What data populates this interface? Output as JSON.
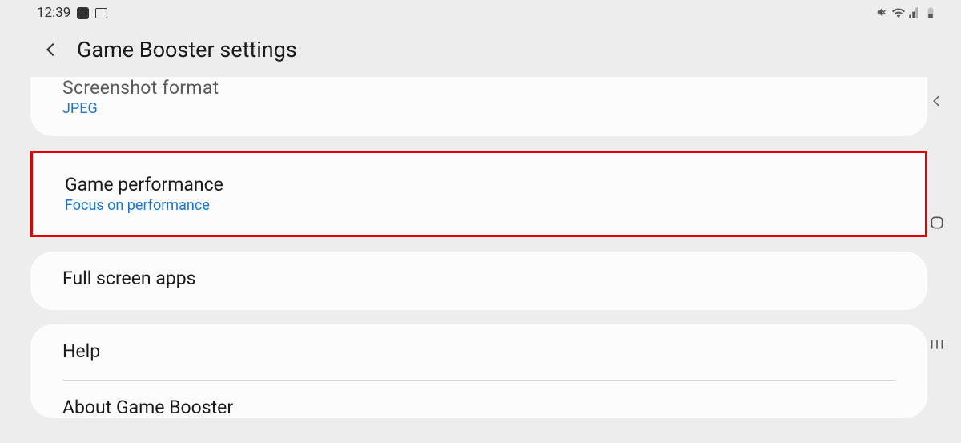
{
  "status_bar": {
    "time": "12:39"
  },
  "header": {
    "title": "Game Booster settings"
  },
  "cards": {
    "screenshot_format": {
      "title": "Screenshot format",
      "value": "JPEG"
    },
    "game_performance": {
      "title": "Game performance",
      "value": "Focus on performance"
    },
    "full_screen_apps": {
      "title": "Full screen apps"
    },
    "help": {
      "title": "Help"
    },
    "about": {
      "title": "About Game Booster"
    }
  }
}
